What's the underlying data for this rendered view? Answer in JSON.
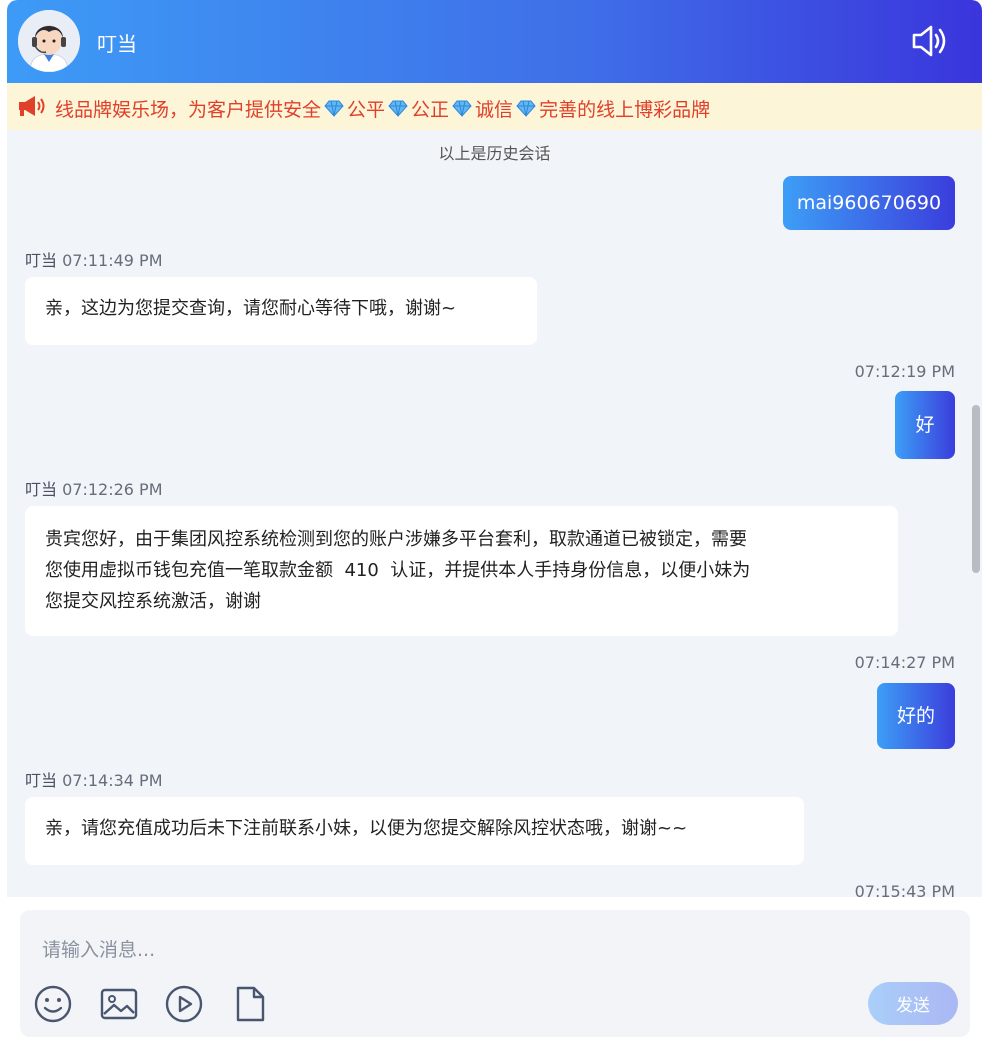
{
  "header": {
    "title": "叮当"
  },
  "notice": {
    "segments": [
      "线品牌娱乐场，为客户提供安全",
      "公平",
      "公正",
      "诚信",
      "完善的线上博彩品牌"
    ]
  },
  "chat": {
    "history_label": "以上是历史会话",
    "messages": [
      {
        "side": "out",
        "text": "mai960670690"
      },
      {
        "side": "in",
        "name": "叮当",
        "time": "07:11:49 PM",
        "text": "亲，这边为您提交查询，请您耐心等待下哦，谢谢~"
      },
      {
        "side": "out",
        "time": "07:12:19 PM",
        "text": "好"
      },
      {
        "side": "in",
        "name": "叮当",
        "time": "07:12:26 PM",
        "lines": [
          "贵宾您好，由于集团风控系统检测到您的账户涉嫌多平台套利，取款通道已被锁定，需要",
          "您使用虚拟币钱包充值一笔取款金额  410  认证，并提供本人手持身份信息，以便小妹为",
          "您提交风控系统激活，谢谢"
        ]
      },
      {
        "side": "out",
        "time": "07:14:27 PM",
        "text": "好的"
      },
      {
        "side": "in",
        "name": "叮当",
        "time": "07:14:34 PM",
        "text": "亲，请您充值成功后未下注前联系小妹，以便为您提交解除风控状态哦，谢谢~~"
      },
      {
        "side": "out",
        "time": "07:15:43 PM",
        "text": ""
      }
    ]
  },
  "composer": {
    "placeholder": "请输入消息...",
    "send_label": "发送",
    "tools": [
      "emoji-icon",
      "image-icon",
      "video-icon",
      "file-icon"
    ]
  },
  "colors": {
    "header_start": "#3d9bf6",
    "header_end": "#3a35dc",
    "notice_bg": "#fdf5d7",
    "notice_text": "#e0402a"
  }
}
